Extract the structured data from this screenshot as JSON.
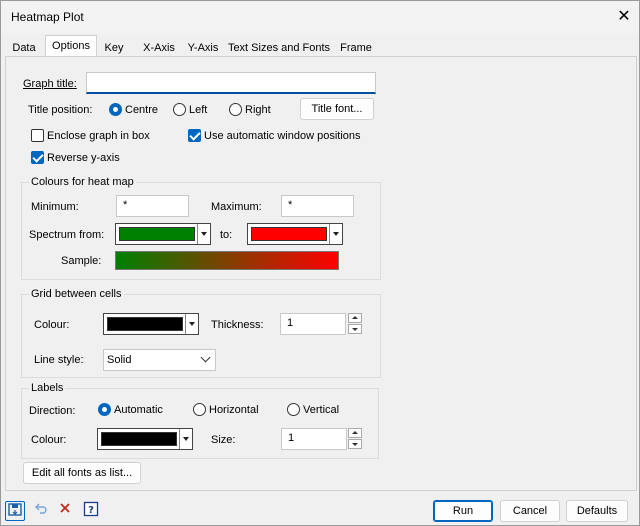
{
  "window": {
    "title": "Heatmap Plot",
    "close_glyph": "✕"
  },
  "tabs": [
    {
      "label": "Data"
    },
    {
      "label": "Options",
      "active": true
    },
    {
      "label": "Key"
    },
    {
      "label": "X-Axis"
    },
    {
      "label": "Y-Axis"
    },
    {
      "label": "Text Sizes and Fonts"
    },
    {
      "label": "Frame"
    }
  ],
  "options": {
    "graph_title_label": "Graph title:",
    "graph_title_value": "",
    "title_position_label": "Title position:",
    "positions": [
      {
        "label": "Centre",
        "selected": true
      },
      {
        "label": "Left",
        "selected": false
      },
      {
        "label": "Right",
        "selected": false
      }
    ],
    "title_font_button": "Title font...",
    "enclose_label": "Enclose graph in box",
    "enclose_checked": false,
    "auto_window_label": "Use automatic window positions",
    "auto_window_checked": true,
    "reverse_y_label": "Reverse y-axis",
    "reverse_y_checked": true
  },
  "colours": {
    "group_title": "Colours for heat map",
    "minimum_label": "Minimum:",
    "minimum_value": "*",
    "maximum_label": "Maximum:",
    "maximum_value": "*",
    "spectrum_from_label": "Spectrum from:",
    "spectrum_to_label": "to:",
    "from_color": "#008000",
    "to_color": "#ff0000",
    "sample_label": "Sample:"
  },
  "grid": {
    "group_title": "Grid between cells",
    "colour_label": "Colour:",
    "colour": "#000000",
    "thickness_label": "Thickness:",
    "thickness_value": "1",
    "line_style_label": "Line style:",
    "line_style_value": "Solid"
  },
  "labels": {
    "group_title": "Labels",
    "direction_label": "Direction:",
    "directions": [
      {
        "label": "Automatic",
        "selected": true
      },
      {
        "label": "Horizontal",
        "selected": false
      },
      {
        "label": "Vertical",
        "selected": false
      }
    ],
    "colour_label": "Colour:",
    "colour": "#000000",
    "size_label": "Size:",
    "size_value": "1"
  },
  "edit_fonts_button": "Edit all fonts as list...",
  "footer": {
    "run": "Run",
    "cancel": "Cancel",
    "defaults": "Defaults",
    "tools": [
      "save-defaults-icon",
      "undo-icon",
      "clear-icon",
      "help-icon"
    ]
  }
}
